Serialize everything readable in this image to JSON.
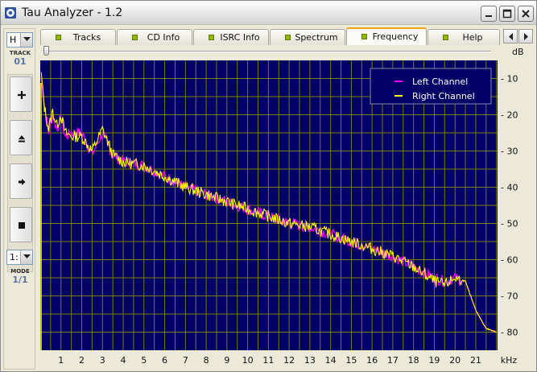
{
  "window": {
    "title": "Tau Analyzer - 1.2",
    "title_icon": "tau-app-icon"
  },
  "left_panel": {
    "top_combo_value": "H",
    "track_label": "TRACK",
    "track_number": "01",
    "buttons": [
      {
        "name": "add-button",
        "icon": "plus-icon"
      },
      {
        "name": "eject-button",
        "icon": "eject-icon"
      },
      {
        "name": "next-button",
        "icon": "arrow-right-icon"
      },
      {
        "name": "stop-button",
        "icon": "stop-square-icon"
      }
    ],
    "bottom_combo_value": "1:",
    "mode_label": "MODE",
    "mode_value": "1/1"
  },
  "tabs": [
    {
      "label": "Tracks",
      "active": false
    },
    {
      "label": "CD Info",
      "active": false
    },
    {
      "label": "ISRC Info",
      "active": false
    },
    {
      "label": "Spectrum",
      "active": false
    },
    {
      "label": "Frequency",
      "active": true
    },
    {
      "label": "Help",
      "active": false
    }
  ],
  "db_unit_label": "dB",
  "colors": {
    "plot_bg": "#000066",
    "grid": "#7b7b00",
    "left_channel": "#ff00ff",
    "right_channel": "#ffff00",
    "tab_led": "#8fb800"
  },
  "chart_data": {
    "type": "line",
    "title": "",
    "xlabel": "kHz",
    "ylabel": "dB",
    "xlim": [
      0,
      22.05
    ],
    "ylim": [
      -85,
      -5
    ],
    "x_ticks": [
      "1",
      "2",
      "3",
      "4",
      "5",
      "6",
      "7",
      "8",
      "9",
      "10",
      "11",
      "12",
      "13",
      "14",
      "15",
      "16",
      "17",
      "18",
      "19",
      "20",
      "21"
    ],
    "y_ticks": [
      "- 10",
      "- 20",
      "- 30",
      "- 40",
      "- 50",
      "- 60",
      "- 70",
      "- 80"
    ],
    "legend": [
      "Left Channel",
      "Right Channel"
    ],
    "legend_position": "top-right",
    "grid": true,
    "series": [
      {
        "name": "Left Channel",
        "x": [
          0.05,
          0.2,
          0.4,
          0.6,
          0.8,
          1.0,
          1.2,
          1.5,
          2.0,
          2.5,
          3.0,
          3.5,
          4.0,
          5.0,
          6.0,
          7.0,
          8.0,
          9.0,
          10.0,
          11.0,
          12.0,
          13.0,
          14.0,
          15.0,
          16.0,
          17.0,
          18.0,
          19.0,
          19.5,
          20.0,
          20.5,
          21.0,
          21.5,
          22.0
        ],
        "y": [
          -10,
          -17,
          -25,
          -20,
          -24,
          -21,
          -26,
          -25,
          -25,
          -31,
          -25,
          -31,
          -33,
          -34,
          -37,
          -40,
          -42,
          -44,
          -46,
          -48,
          -50,
          -51,
          -53,
          -55,
          -57,
          -59,
          -62,
          -65,
          -66,
          -65,
          -66,
          -74,
          -79,
          -80
        ]
      },
      {
        "name": "Right Channel",
        "x": [
          0.05,
          0.2,
          0.4,
          0.6,
          0.8,
          1.0,
          1.2,
          1.5,
          2.0,
          2.5,
          3.0,
          3.5,
          4.0,
          5.0,
          6.0,
          7.0,
          8.0,
          9.0,
          10.0,
          11.0,
          12.0,
          13.0,
          14.0,
          15.0,
          16.0,
          17.0,
          18.0,
          19.0,
          19.5,
          20.0,
          20.5,
          21.0,
          21.5,
          22.0
        ],
        "y": [
          -9,
          -18,
          -24,
          -19,
          -23,
          -20,
          -25,
          -26,
          -26,
          -30,
          -24,
          -31,
          -33,
          -34,
          -37,
          -40,
          -42,
          -44,
          -46,
          -48,
          -50,
          -51,
          -53,
          -55,
          -57,
          -59,
          -62,
          -66,
          -67,
          -65,
          -66,
          -74,
          -79,
          -80
        ]
      }
    ]
  }
}
